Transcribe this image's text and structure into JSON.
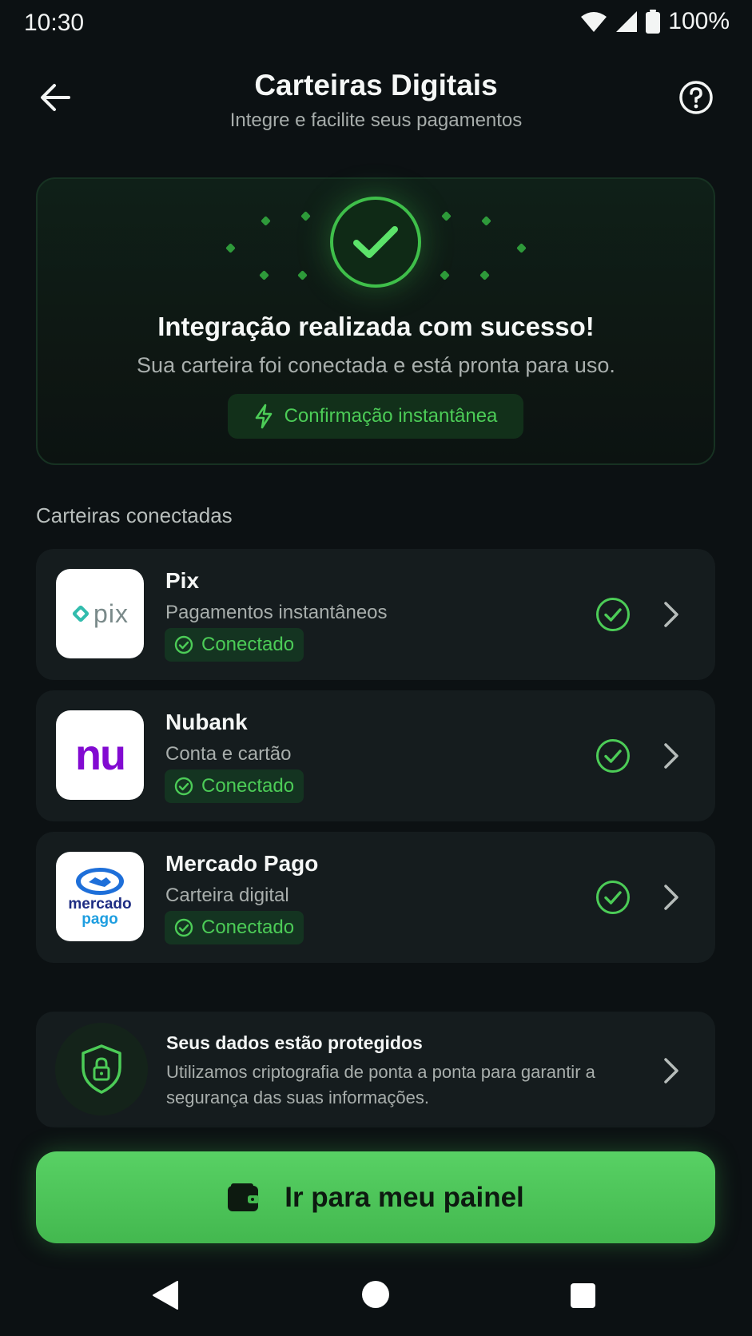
{
  "status_bar": {
    "time": "10:30",
    "battery": "100%"
  },
  "header": {
    "title": "Carteiras Digitais",
    "subtitle": "Integre e facilite seus pagamentos"
  },
  "success": {
    "title": "Integração realizada com sucesso!",
    "description": "Sua carteira foi conectada e está pronta para uso.",
    "badge": "Confirmação instantânea"
  },
  "section_title": "Carteiras conectadas",
  "wallets": [
    {
      "name": "Pix",
      "description": "Pagamentos instantâneos",
      "status": "Conectado",
      "logo_text": "pix"
    },
    {
      "name": "Nubank",
      "description": "Conta e cartão",
      "status": "Conectado",
      "logo_text": "nu"
    },
    {
      "name": "Mercado Pago",
      "description": "Carteira digital",
      "status": "Conectado",
      "logo_text_1": "mercado",
      "logo_text_2": "pago"
    }
  ],
  "security": {
    "title": "Seus dados estão protegidos",
    "text": "Utilizamos criptografia de ponta a ponta para garantir a segurança das suas informações."
  },
  "cta": {
    "label": "Ir para meu painel"
  },
  "colors": {
    "background": "#0c1113",
    "accent_green": "#4ccc57",
    "card": "#151c1e",
    "nubank_purple": "#820ad1",
    "pix_teal": "#32bcad",
    "mercado_navy": "#1e2d83"
  },
  "icons": {
    "back": "arrow-left-icon",
    "help": "question-circle-icon",
    "success": "check-circle-icon",
    "instant": "bolt-icon",
    "connected": "check-circle-icon",
    "chevron": "chevron-right-icon",
    "security": "shield-lock-icon",
    "wallet": "wallet-icon"
  }
}
